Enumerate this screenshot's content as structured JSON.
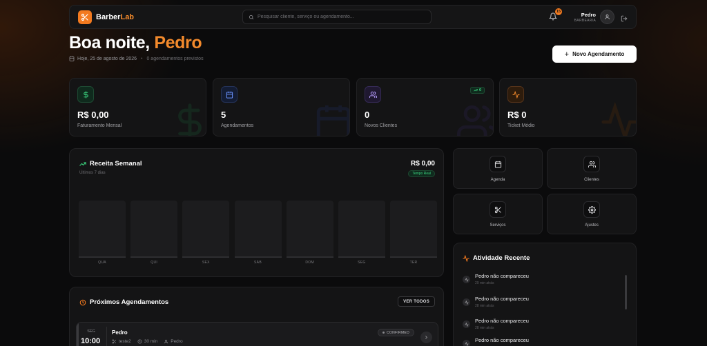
{
  "brand": {
    "name_main": "Barber",
    "name_accent": "Lab"
  },
  "search": {
    "placeholder": "Pesquisar cliente, serviço ou agendamento..."
  },
  "notifications": {
    "count": "15"
  },
  "user": {
    "name": "Pedro",
    "role": "BARBEARIA"
  },
  "greeting": {
    "prefix": "Boa noite, ",
    "name": "Pedro",
    "date": "Hoje, 25 de agosto de 2026",
    "appointments_note": "0 agendamentos previstos"
  },
  "new_appointment": {
    "label": "Novo Agendamento"
  },
  "stats": [
    {
      "icon": "dollar-icon",
      "value": "R$ 0,00",
      "label": "Faturamento Mensal",
      "color": "#3bd37e"
    },
    {
      "icon": "calendar-icon",
      "value": "5",
      "label": "Agendamentos",
      "color": "#5b8cff"
    },
    {
      "icon": "users-icon",
      "value": "0",
      "label": "Novos Clientes",
      "color": "#a78bfa",
      "trend": "0"
    },
    {
      "icon": "activity-icon",
      "value": "R$ 0",
      "label": "Ticket Médio",
      "color": "#f38a2c"
    }
  ],
  "weekly_revenue": {
    "title": "Receita Semanal",
    "subtitle": "Últimos 7 dias",
    "total": "R$ 0,00",
    "live": "Tempo Real",
    "days": [
      "QUA",
      "QUI",
      "SEX",
      "SÁB",
      "DOM",
      "SEG",
      "TER"
    ],
    "values": [
      0,
      0,
      0,
      0,
      0,
      0,
      0
    ]
  },
  "quick_actions": [
    {
      "icon": "calendar-icon",
      "label": "Agenda"
    },
    {
      "icon": "users-icon",
      "label": "Clientes"
    },
    {
      "icon": "scissors-icon",
      "label": "Serviços"
    },
    {
      "icon": "gear-icon",
      "label": "Ajustes"
    }
  ],
  "upcoming": {
    "title": "Próximos Agendamentos",
    "see_all": "VER TODOS",
    "items": [
      {
        "day": "SEG",
        "time": "10:00",
        "client": "Pedro",
        "service": "teste2",
        "duration": "30 min",
        "barber": "Pedro",
        "status": "CONFIRMED"
      }
    ]
  },
  "activity": {
    "title": "Atividade Recente",
    "items": [
      {
        "title": "Pedro não compareceu",
        "time": "29 min atrás"
      },
      {
        "title": "Pedro não compareceu",
        "time": "28 min atrás"
      },
      {
        "title": "Pedro não compareceu",
        "time": "28 min atrás"
      },
      {
        "title": "Pedro não compareceu",
        "time": ""
      }
    ]
  },
  "colors": {
    "accent": "#f37a1f",
    "success": "#3bd37e",
    "surface": "#141415",
    "background": "#0b0b0c"
  }
}
